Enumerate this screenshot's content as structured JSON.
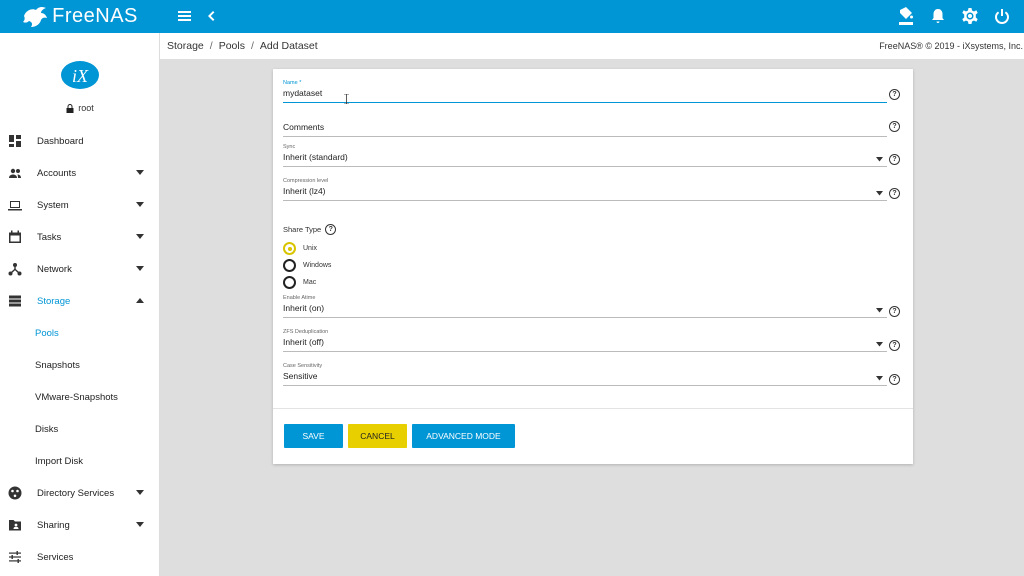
{
  "brand": {
    "name": "FreeNAS"
  },
  "user": {
    "name": "root"
  },
  "nav": {
    "items": [
      {
        "label": "Dashboard"
      },
      {
        "label": "Accounts"
      },
      {
        "label": "System"
      },
      {
        "label": "Tasks"
      },
      {
        "label": "Network"
      },
      {
        "label": "Storage"
      },
      {
        "label": "Pools"
      },
      {
        "label": "Snapshots"
      },
      {
        "label": "VMware-Snapshots"
      },
      {
        "label": "Disks"
      },
      {
        "label": "Import Disk"
      },
      {
        "label": "Directory Services"
      },
      {
        "label": "Sharing"
      },
      {
        "label": "Services"
      }
    ]
  },
  "breadcrumb": [
    "Storage",
    "Pools",
    "Add Dataset"
  ],
  "copyright": "FreeNAS® © 2019 - iXsystems, Inc.",
  "form": {
    "name": {
      "label": "Name *",
      "value": "mydataset"
    },
    "comments": {
      "placeholder": "Comments"
    },
    "sync": {
      "label": "Sync",
      "value": "Inherit (standard)"
    },
    "compression": {
      "label": "Compression level",
      "value": "Inherit (lz4)"
    },
    "share_type": {
      "label": "Share Type",
      "options": [
        "Unix",
        "Windows",
        "Mac"
      ],
      "selected": "Unix"
    },
    "atime": {
      "label": "Enable Atime",
      "value": "Inherit (on)"
    },
    "dedup": {
      "label": "ZFS Deduplication",
      "value": "Inherit (off)"
    },
    "case": {
      "label": "Case Sensitivity",
      "value": "Sensitive"
    },
    "buttons": {
      "save": "SAVE",
      "cancel": "CANCEL",
      "advanced": "ADVANCED MODE"
    }
  },
  "colors": {
    "primary": "#0095d5",
    "accent": "#e8d000"
  }
}
